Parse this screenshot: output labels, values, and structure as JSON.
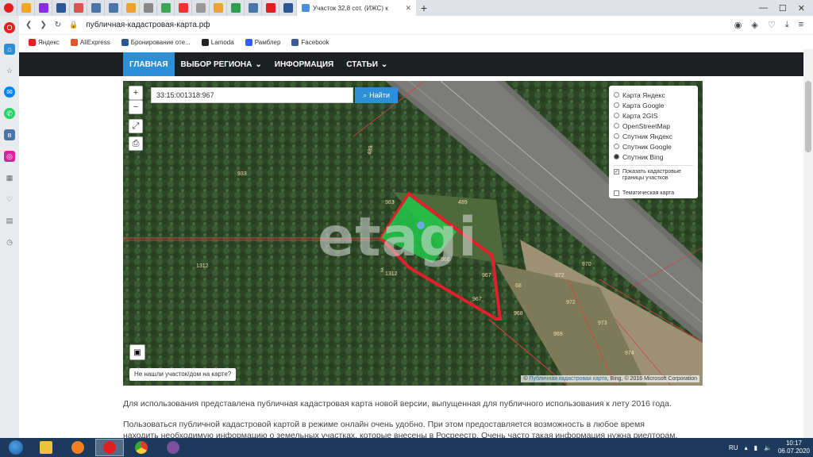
{
  "browser": {
    "active_tab_title": "Участок 32,8 сот. (ИЖС) к",
    "url": "публичная-кадастровая-карта.рф",
    "bookmarks": [
      "Яндекс",
      "AliExpress",
      "Бронирование оте...",
      "Lamoda",
      "Рамблер",
      "Facebook"
    ]
  },
  "nav": {
    "home": "ГЛАВНАЯ",
    "region": "ВЫБОР РЕГИОНА",
    "info": "ИНФОРМАЦИЯ",
    "articles": "СТАТЬИ"
  },
  "map": {
    "search_value": "33:15:001318:967",
    "search_button": "Найти",
    "zoom_in": "+",
    "zoom_out": "−",
    "layers": [
      {
        "label": "Карта Яндекс",
        "selected": false
      },
      {
        "label": "Карта Google",
        "selected": false
      },
      {
        "label": "Карта 2GIS",
        "selected": false
      },
      {
        "label": "OpenStreetMap",
        "selected": false
      },
      {
        "label": "Спутник Яндекс",
        "selected": false
      },
      {
        "label": "Спутник Google",
        "selected": false
      },
      {
        "label": "Спутник Bing",
        "selected": true
      }
    ],
    "show_borders_label": "Показать кадастровые границы участков",
    "thematic_label": "Тематическая карта",
    "not_found_label": "Не нашли участок/дом на карте?",
    "attribution_link": "Публичная кадастровая карта",
    "attribution_rest": ", Bing, © 2016 Microsoft Corporation",
    "watermark": "etagi",
    "plot_labels": [
      "933",
      "489",
      "983",
      "489",
      "1312",
      "1312",
      "3",
      "966",
      "967",
      "967",
      "68",
      "968",
      "972",
      "972",
      "973",
      "970",
      "969",
      "974"
    ]
  },
  "content": {
    "para1": "Для использования представлена публичная кадастровая карта новой версии, выпущенная для публичного использования к лету 2016 года.",
    "para2": "Пользоваться публичной кадастровой картой в режиме онлайн очень удобно. При этом предоставляется возможность в любое время находить необходимую информацию о земельных участках, которые внесены в Росреестр. Очень часто такая информация нужна риелторам, юристам"
  },
  "taskbar": {
    "lang": "RU",
    "time": "10:17",
    "date": "06.07.2020"
  },
  "colors": {
    "nav_bg": "#1d1f22",
    "accent": "#2d8fd5",
    "plot_fill": "#22c84a",
    "plot_border": "#e0202a"
  }
}
